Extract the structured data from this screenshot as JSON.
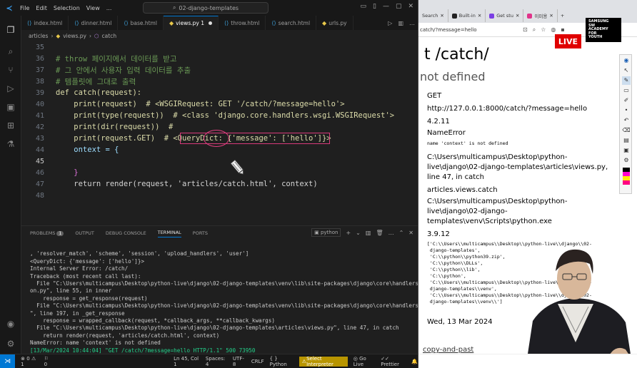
{
  "vscode": {
    "menu": [
      "File",
      "Edit",
      "Selection",
      "View",
      "..."
    ],
    "command_center": "02-django-templates",
    "tabs": [
      {
        "label": "index.html",
        "active": false
      },
      {
        "label": "dinner.html",
        "active": false
      },
      {
        "label": "base.html",
        "active": false
      },
      {
        "label": "views.py 1",
        "active": true,
        "modified": true
      },
      {
        "label": "throw.html",
        "active": false
      },
      {
        "label": "search.html",
        "active": false
      },
      {
        "label": "urls.py",
        "active": false
      }
    ],
    "breadcrumb": [
      "articles",
      "views.py",
      "catch"
    ],
    "code": [
      {
        "n": "35",
        "text": ""
      },
      {
        "n": "36",
        "text": "# throw 페이지에서 데이터를 받고"
      },
      {
        "n": "37",
        "text": "# 그 안에서 사용자 입력 데이터를 추출"
      },
      {
        "n": "38",
        "text": "# 템플릿에 그대로 출력"
      },
      {
        "n": "39",
        "text": "def catch(request):"
      },
      {
        "n": "40",
        "text": "    print(request)  # <WSGIRequest: GET '/catch/?message=hello'>"
      },
      {
        "n": "41",
        "text": "    print(type(request))  # <class 'django.core.handlers.wsgi.WSGIRequest'>"
      },
      {
        "n": "42",
        "text": "    print(dir(request))  #"
      },
      {
        "n": "43",
        "text": "    print(request.GET)  # <QueryDict: {'message': ['hello']}>"
      },
      {
        "n": "44",
        "text": "    ontext = {"
      },
      {
        "n": "45",
        "text": ""
      },
      {
        "n": "46",
        "text": "    }"
      },
      {
        "n": "47",
        "text": "    return render(request, 'articles/catch.html', context)"
      },
      {
        "n": "48",
        "text": ""
      }
    ],
    "panel_tabs": {
      "problems": "PROBLEMS",
      "problems_count": "1",
      "output": "OUTPUT",
      "debug": "DEBUG CONSOLE",
      "terminal": "TERMINAL",
      "ports": "PORTS",
      "shell": "python"
    },
    "terminal": [
      ", 'resolver_match', 'scheme', 'session', 'upload_handlers', 'user']",
      "<QueryDict: {'message': ['hello']}>",
      "Internal Server Error: /catch/",
      "Traceback (most recent call last):",
      "  File \"C:\\Users\\multicampus\\Desktop\\python-live\\django\\02-django-templates\\venv\\lib\\site-packages\\django\\core\\handlers\\excepti",
      "on.py\", line 55, in inner",
      "    response = get_response(request)",
      "  File \"C:\\Users\\multicampus\\Desktop\\python-live\\django\\02-django-templates\\venv\\lib\\site-packages\\django\\core\\handlers\\base.py",
      "\", line 197, in _get_response",
      "    response = wrapped_callback(request, *callback_args, **callback_kwargs)",
      "  File \"C:\\Users\\multicampus\\Desktop\\python-live\\django\\02-django-templates\\articles\\views.py\", line 47, in catch",
      "    return render(request, 'articles/catch.html', context)",
      "NameError: name 'context' is not defined",
      "[13/Mar/2024 10:44:04] \"GET /catch/?message=hello HTTP/1.1\" 500 73950",
      "|"
    ],
    "status": {
      "problems": "⊗ 0 ⚠ 1",
      "ports": "0",
      "position": "Ln 45, Col 1",
      "spaces": "Spaces: 4",
      "encoding": "UTF-8",
      "eol": "CRLF",
      "language": "Python",
      "interpreter": "Select Interpreter",
      "golive": "Go Live",
      "prettier": "Prettier"
    }
  },
  "browser": {
    "tabs": [
      "Search",
      "Built-in",
      "Get stu",
      "이미용"
    ],
    "address": "catch/?message=hello",
    "live_badge": "LIVE",
    "samsung_logo": "SAMSUNG SW ACADEMY FOR YOUTH",
    "error_title": "t /catch/",
    "error_subtitle": "not defined",
    "fields": [
      {
        "key": "method",
        "value": "GET"
      },
      {
        "key": "url",
        "value": "http://127.0.0.1:8000/catch/?message=hello"
      },
      {
        "key": "version",
        "value": "4.2.11"
      },
      {
        "key": "exc_type",
        "value": "NameError"
      },
      {
        "key": "exc_value",
        "value": "name 'context' is not defined"
      },
      {
        "key": "location",
        "value": "C:\\Users\\multicampus\\Desktop\\python-live\\django\\02-django-templates\\articles\\views.py, line 47, in catch"
      },
      {
        "key": "raised_during",
        "value": "articles.views.catch"
      },
      {
        "key": "executable",
        "value": "C:\\Users\\multicampus\\Desktop\\python-live\\django\\02-django-templates\\venv\\Scripts\\python.exe"
      },
      {
        "key": "py_version",
        "value": "3.9.12"
      },
      {
        "key": "py_path",
        "value": "['C:\\\\Users\\\\multicampus\\\\Desktop\\\\python-live\\\\django\\\\02-\n django-templates',\n 'C:\\\\python\\\\python39.zip',\n 'C:\\\\python\\\\DLLs',\n 'C:\\\\python\\\\lib',\n 'C:\\\\python',\n 'C:\\\\Users\\\\multicampus\\\\Desktop\\\\python-live\\\\django\\\\02-\n django-templates\\\\venv',\n 'C:\\\\Users\\\\multicampus\\\\Desktop\\\\python-live\\\\django\\\\02-\n django-templates\\\\venv\\\\']"
      },
      {
        "key": "server_time",
        "value": "Wed, 13 Mar 2024"
      }
    ],
    "footer_link": "copy-and-past"
  },
  "colors": {
    "accent": "#0078d4",
    "annotation": "#d83a7a",
    "live": "#e00000"
  }
}
